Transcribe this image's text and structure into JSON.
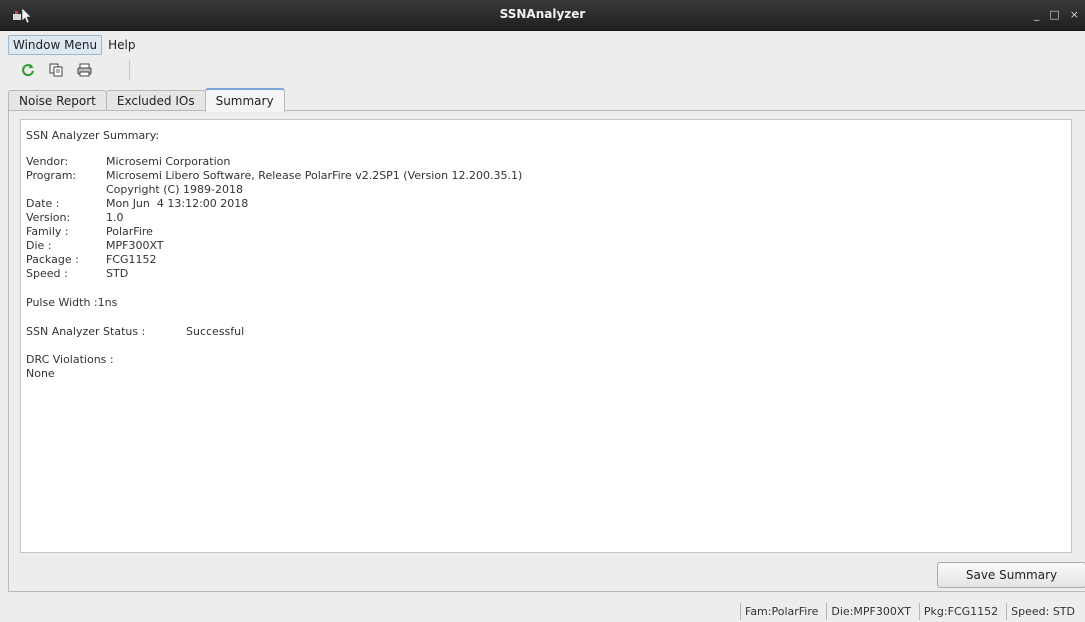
{
  "window": {
    "title": "SSNAnalyzer",
    "minimize_glyph": "_",
    "maximize_glyph": "□",
    "close_glyph": "×"
  },
  "menu": {
    "items": [
      {
        "label": "Window Menu",
        "active": true
      },
      {
        "label": "Help",
        "active": false
      }
    ]
  },
  "toolbar": {
    "icons": [
      "refresh-icon",
      "copy-icon",
      "print-icon"
    ]
  },
  "tabs": [
    {
      "label": "Noise Report",
      "selected": false
    },
    {
      "label": "Excluded IOs",
      "selected": false
    },
    {
      "label": "Summary",
      "selected": true
    }
  ],
  "summary": {
    "heading": "SSN Analyzer Summary:",
    "fields": [
      {
        "label": "Vendor:",
        "value": "Microsemi Corporation"
      },
      {
        "label": "Program:",
        "value": "Microsemi Libero Software, Release PolarFire v2.2SP1 (Version 12.200.35.1)"
      },
      {
        "label": "",
        "value": "Copyright (C) 1989-2018"
      },
      {
        "label": "Date :",
        "value": "Mon Jun  4 13:12:00 2018"
      },
      {
        "label": "Version:",
        "value": "1.0"
      },
      {
        "label": "Family :",
        "value": "PolarFire"
      },
      {
        "label": "Die :",
        "value": "MPF300XT"
      },
      {
        "label": "Package :",
        "value": "FCG1152"
      },
      {
        "label": "Speed :",
        "value": "STD"
      }
    ],
    "pulse_width": "Pulse Width :1ns",
    "status_label": "SSN Analyzer Status :",
    "status_value": "Successful",
    "drc_label": "DRC Violations :",
    "drc_value": "None"
  },
  "buttons": {
    "save_summary": "Save Summary"
  },
  "statusbar": {
    "family": "Fam:PolarFire",
    "die": "Die:MPF300XT",
    "package": "Pkg:FCG1152",
    "speed": "Speed: STD"
  },
  "colors": {
    "titlebar": "#2a2a2a",
    "tab_accent": "#7aa5d6",
    "refresh_icon": "#2f9a2f"
  }
}
